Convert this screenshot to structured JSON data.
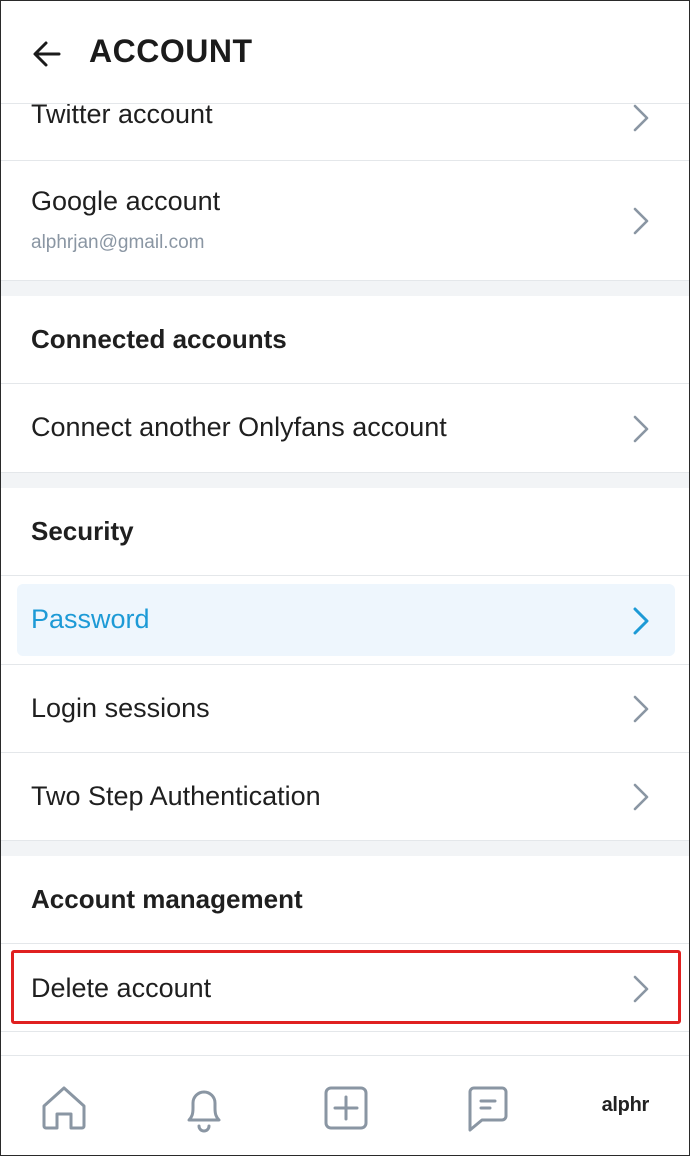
{
  "header": {
    "title": "ACCOUNT",
    "back_icon": "arrow-left-icon"
  },
  "rows": {
    "twitter": {
      "label": "Twitter account"
    },
    "google": {
      "label": "Google account",
      "email": "alphrjan@gmail.com"
    },
    "connect_another": {
      "label": "Connect another Onlyfans account"
    },
    "password": {
      "label": "Password"
    },
    "login_sessions": {
      "label": "Login sessions"
    },
    "two_step": {
      "label": "Two Step Authentication"
    },
    "delete_account": {
      "label": "Delete account"
    }
  },
  "sections": {
    "connected_accounts": "Connected accounts",
    "security": "Security",
    "account_management": "Account management"
  },
  "bottom_nav": {
    "items": [
      "home-icon",
      "bell-icon",
      "plus-square-icon",
      "message-icon"
    ],
    "watermark": "alphr"
  },
  "colors": {
    "accent": "#1d9ad6",
    "highlight_bg": "#eef6fd",
    "annotation_red": "#e02020",
    "chevron": "#8a96a3"
  }
}
